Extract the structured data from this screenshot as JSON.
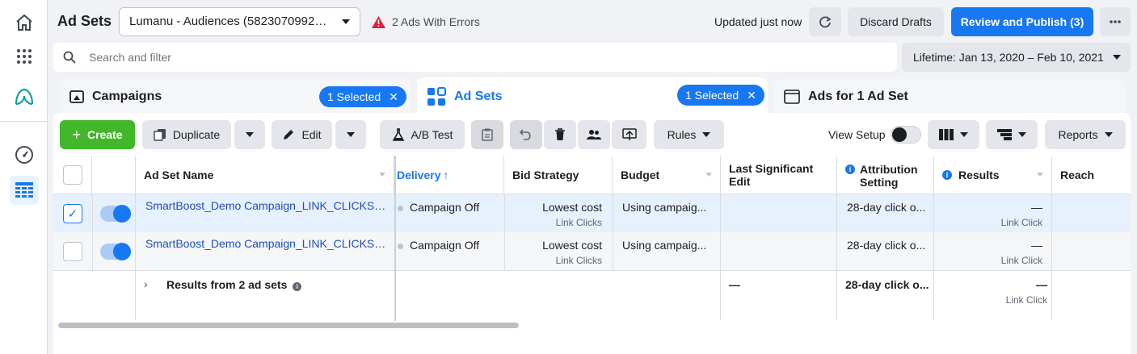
{
  "nav": {
    "items": [
      "home-icon",
      "apps-grid-icon",
      "ads-manager-logo-icon",
      "gauge-icon",
      "table-icon"
    ]
  },
  "header": {
    "title": "Ad Sets",
    "account": "Lumanu - Audiences (5823070992589...",
    "errors": "2 Ads With Errors",
    "updated": "Updated just now",
    "discard": "Discard Drafts",
    "publish": "Review and Publish (3)"
  },
  "search": {
    "placeholder": "Search and filter"
  },
  "date_range": "Lifetime: Jan 13, 2020 – Feb 10, 2021",
  "tabs": [
    {
      "label": "Campaigns",
      "pill": "1 Selected"
    },
    {
      "label": "Ad Sets",
      "pill": "1 Selected"
    },
    {
      "label": "Ads for 1 Ad Set"
    }
  ],
  "toolbar": {
    "create": "Create",
    "duplicate": "Duplicate",
    "edit": "Edit",
    "ab_test": "A/B Test",
    "rules": "Rules",
    "view_setup": "View Setup",
    "reports": "Reports"
  },
  "table": {
    "headers": {
      "name": "Ad Set Name",
      "delivery": "Delivery",
      "bid": "Bid Strategy",
      "budget": "Budget",
      "last_edit": "Last Significant Edit",
      "attribution": "Attribution Setting",
      "results": "Results",
      "reach": "Reach"
    },
    "rows": [
      {
        "name": "SmartBoost_Demo Campaign_LINK_CLICKS_...",
        "delivery": "Campaign Off",
        "bid": "Lowest cost",
        "bid_sub": "Link Clicks",
        "budget": "Using campaig...",
        "attribution": "28-day click o...",
        "results": "—",
        "results_sub": "Link Click"
      },
      {
        "name": "SmartBoost_Demo Campaign_LINK_CLICKS_...",
        "delivery": "Campaign Off",
        "bid": "Lowest cost",
        "bid_sub": "Link Clicks",
        "budget": "Using campaig...",
        "attribution": "28-day click o...",
        "results": "—",
        "results_sub": "Link Click"
      }
    ],
    "summary": {
      "label": "Results from 2 ad sets",
      "last_edit": "—",
      "attribution": "28-day click o...",
      "results": "—",
      "results_sub": "Link Click"
    }
  }
}
